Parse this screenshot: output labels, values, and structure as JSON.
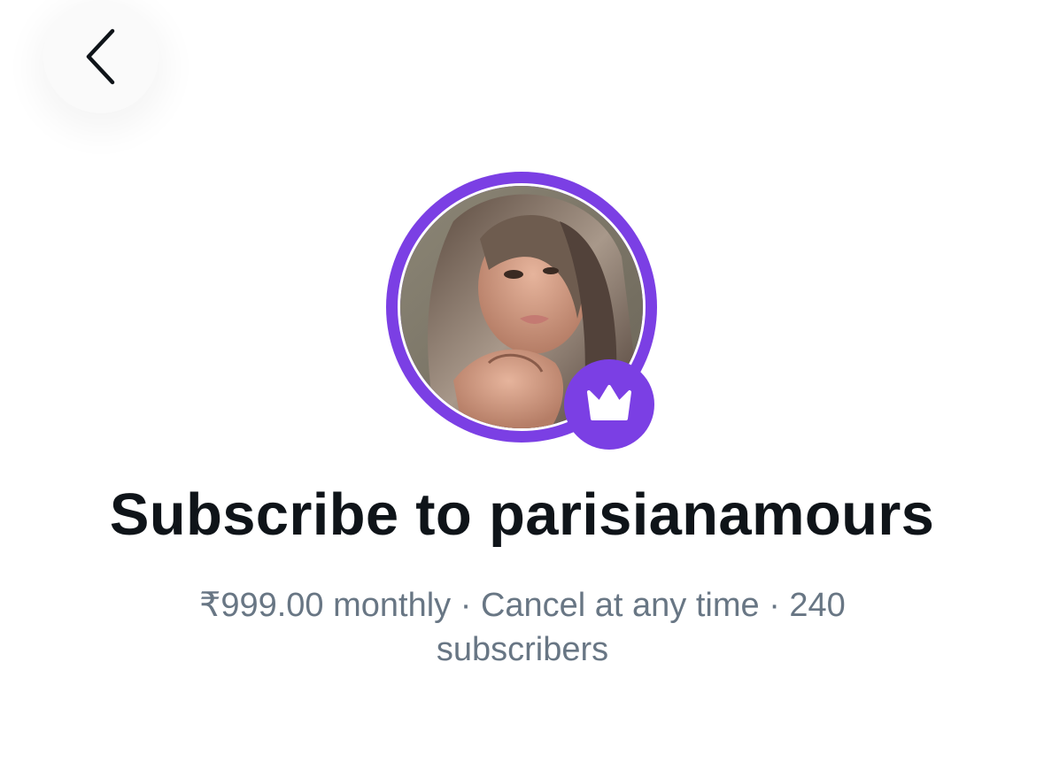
{
  "header": {
    "back_icon": "chevron-left-icon"
  },
  "profile": {
    "avatar_alt": "parisianamours profile photo",
    "ring_color": "#7b3fe4",
    "badge_icon": "crown-icon",
    "badge_color": "#7b3fe4"
  },
  "subscribe": {
    "title": "Subscribe to parisianamours",
    "details": "₹999.00 monthly · Cancel at any time · 240 subscribers"
  },
  "colors": {
    "accent": "#7b3fe4",
    "title_text": "#0f1419",
    "secondary_text": "#687684"
  }
}
